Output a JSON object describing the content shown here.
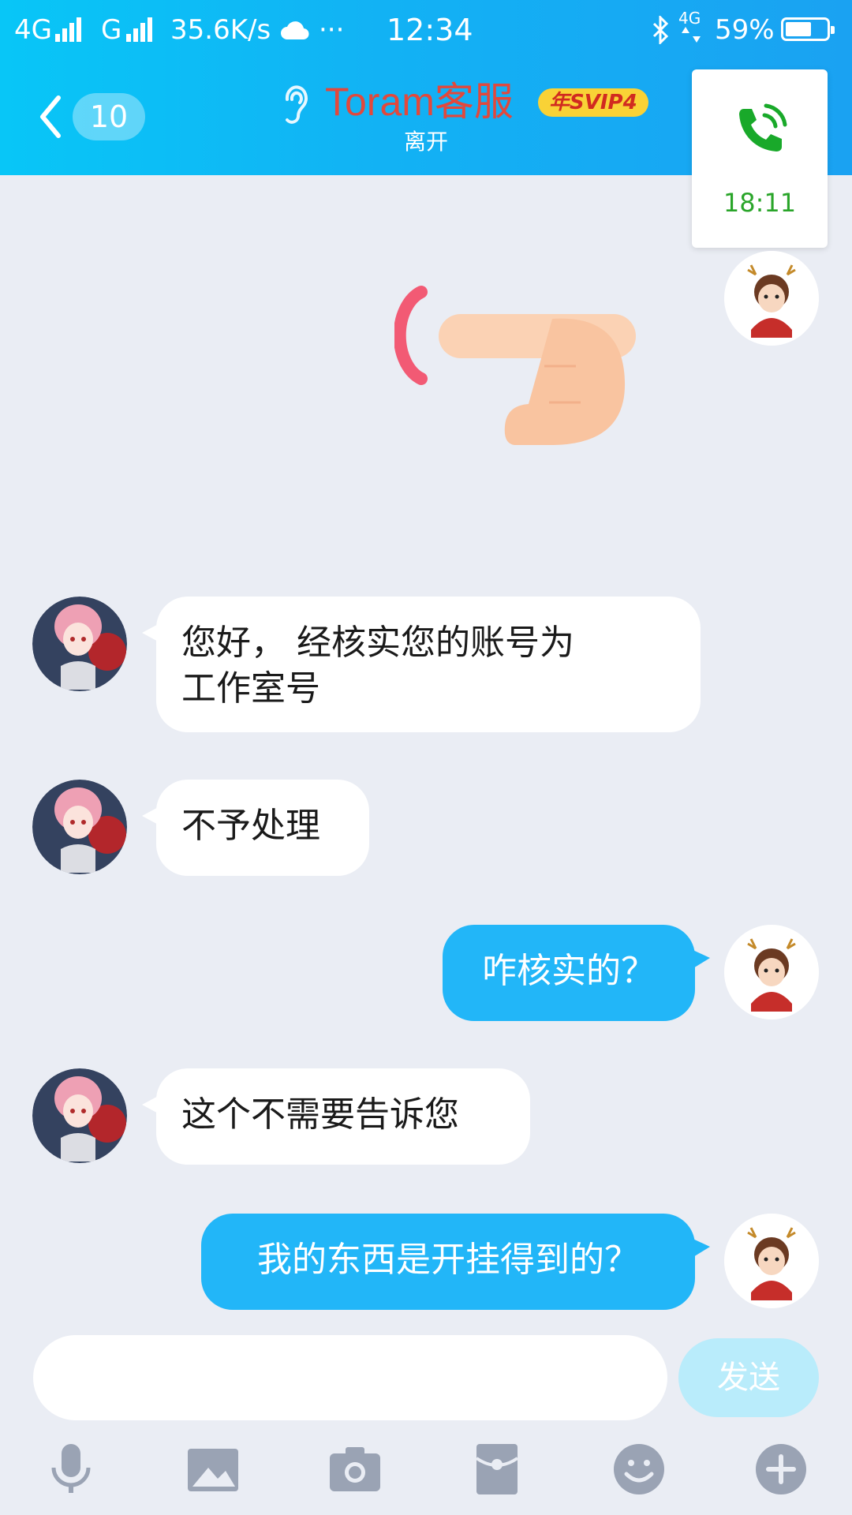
{
  "status_bar": {
    "net1": "4G",
    "net2": "G",
    "speed": "35.6K/s",
    "more": "···",
    "time": "12:34",
    "net3": "4G",
    "battery": "59%"
  },
  "header": {
    "unread_count": "10",
    "title": "Toram客服",
    "badge": "年SVIP4",
    "status": "离开"
  },
  "call_card": {
    "duration": "18:11"
  },
  "messages": [
    {
      "from": "other",
      "text_line1": "您好， 经核实您的账号为",
      "text_line2": "工作室号"
    },
    {
      "from": "other",
      "text": "不予处理"
    },
    {
      "from": "self",
      "text": "咋核实的？"
    },
    {
      "from": "other",
      "text": "这个不需要告诉您"
    },
    {
      "from": "self",
      "text": "我的东西是开挂得到的？"
    }
  ],
  "input": {
    "placeholder": "",
    "send_label": "发送"
  },
  "toolbar": [
    "mic-icon",
    "image-icon",
    "camera-icon",
    "red-packet-icon",
    "emoji-icon",
    "plus-icon"
  ],
  "colors": {
    "header_start": "#08c6f7",
    "header_end": "#1aa2f2",
    "outgoing_bubble": "#22b6f8",
    "title": "#e2483c",
    "call_green": "#2aa52a"
  }
}
